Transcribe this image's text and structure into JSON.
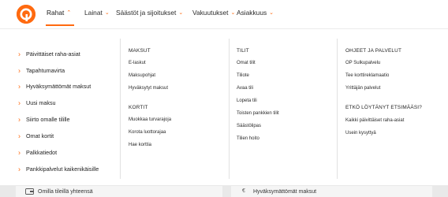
{
  "nav": {
    "items": [
      {
        "label": "Rahat",
        "active": true
      },
      {
        "label": "Lainat"
      },
      {
        "label": "Säästöt ja sijoitukset"
      },
      {
        "label": "Vakuutukset"
      },
      {
        "label": "Asiakkuus"
      }
    ],
    "accent": "#ff6a10",
    "logo_icon": "op-logo-icon"
  },
  "left_menu": [
    "Päivittäiset raha-asiat",
    "Tapahtumavirta",
    "Hyväksymättömät maksut",
    "Uusi maksu",
    "Siirto omalle tilille",
    "Omat kortit",
    "Palkkatiedot",
    "Pankkipalvelut kaikenikäisille"
  ],
  "col_maksut": {
    "header": "MAKSUT",
    "links": [
      "E-laskut",
      "Maksupohjat",
      "Hyväksytyt maksut"
    ]
  },
  "col_kortit": {
    "header": "KORTIT",
    "links": [
      "Muokkaa turvarajoja",
      "Korota luottorajaa",
      "Hae korttia"
    ]
  },
  "col_tilit": {
    "header": "TILIT",
    "links": [
      "Omat tilit",
      "Tiliote",
      "Avaa tili",
      "Lopeta tili",
      "Toisten pankkien tilit",
      "Säästölipas",
      "Tilien hoito"
    ]
  },
  "col_ohjeet": {
    "header": "OHJEET JA PALVELUT",
    "links": [
      "OP Sulkupalvelu",
      "Tee korttireklamaatio",
      "Yrittäjän palvelut"
    ]
  },
  "col_etko": {
    "header": "ETKÖ LÖYTÄNYT ETSIMÄÄSI?",
    "links": [
      "Kaikki päivittäiset raha-asiat",
      "Usein kysyttyä"
    ]
  },
  "footer": {
    "left_label": "Omilla tileillä yhteensä",
    "left_icon": "wallet-icon",
    "right_label": "Hyväksymättömät maksut",
    "right_icon": "euro-icon"
  }
}
